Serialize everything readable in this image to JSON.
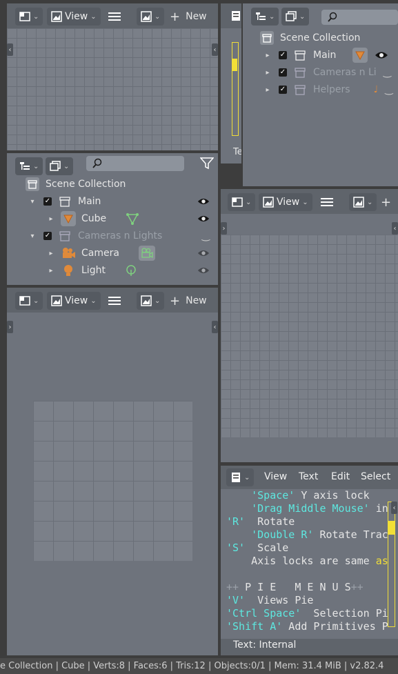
{
  "image_editor": {
    "view_label": "View",
    "new_label": "New"
  },
  "outliner": {
    "scene_collection": "Scene Collection",
    "items": [
      {
        "label": "Main"
      },
      {
        "label": "Cube"
      },
      {
        "label": "Cameras n Lights"
      },
      {
        "label": "Camera"
      },
      {
        "label": "Light"
      }
    ]
  },
  "outliner_top": {
    "scene_collection": "Scene Collection",
    "items": [
      {
        "label": "Main"
      },
      {
        "label": "Cameras n Li"
      },
      {
        "label": "Helpers"
      }
    ]
  },
  "right_viewer": {
    "view_label": "View"
  },
  "text_editor": {
    "menus": [
      "View",
      "Text",
      "Edit",
      "Select"
    ],
    "status": "Text: Internal",
    "partial_tab": "Te"
  },
  "statusbar": {
    "text": "e Collection | Cube | Verts:8 | Faces:6 | Tris:12 | Objects:0/1 | Mem: 31.4 MiB | v2.82.4"
  },
  "colors": {
    "panel": "#6e737c",
    "header": "#5f646b",
    "string": "#5de8e0",
    "keyword": "#f2df37",
    "object_orange": "#e08a3a",
    "data_green": "#7fd07f"
  }
}
